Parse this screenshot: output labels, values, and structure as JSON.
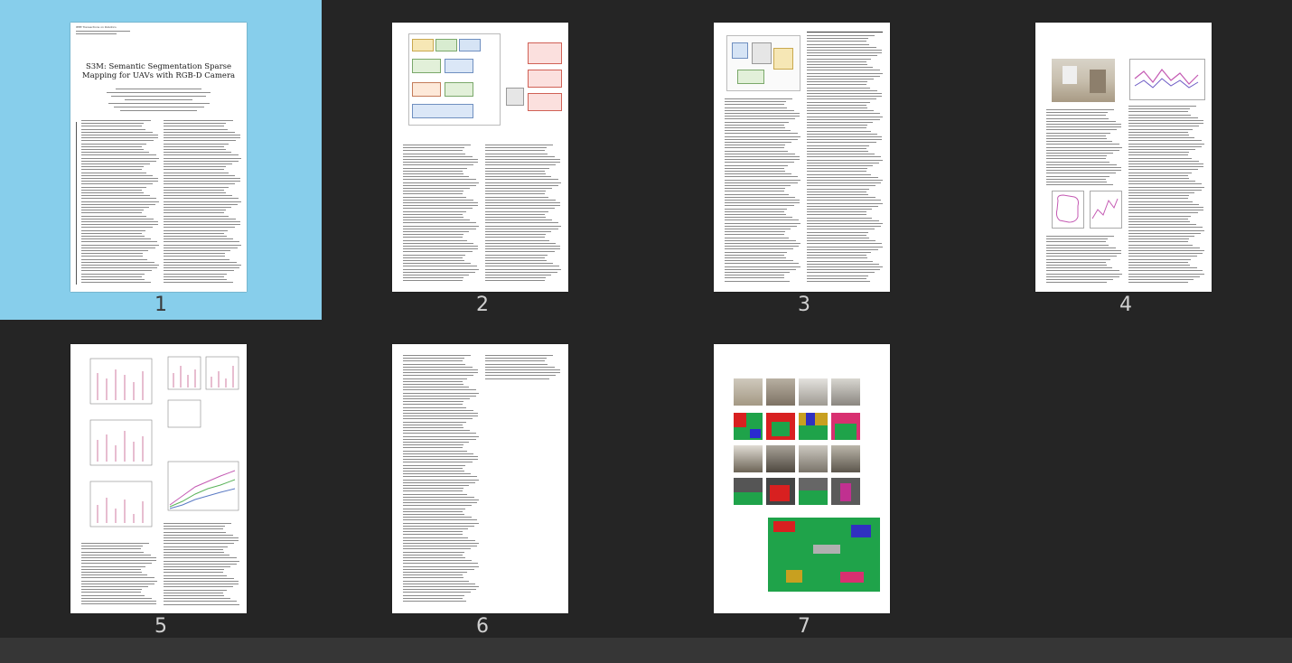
{
  "viewer": {
    "selected_page": 1,
    "pages": [
      {
        "number": "1"
      },
      {
        "number": "2"
      },
      {
        "number": "3"
      },
      {
        "number": "4"
      },
      {
        "number": "5"
      },
      {
        "number": "6"
      },
      {
        "number": "7"
      }
    ]
  },
  "page1": {
    "header_line1": "IEEE Transactions on Robotics",
    "title": "S3M: Semantic Segmentation Sparse Mapping for UAVs with RGB-D Camera"
  },
  "colors": {
    "background": "#252525",
    "selection": "#87ceeb",
    "statusbar": "#363636",
    "page_number": "#d0d0d0"
  }
}
